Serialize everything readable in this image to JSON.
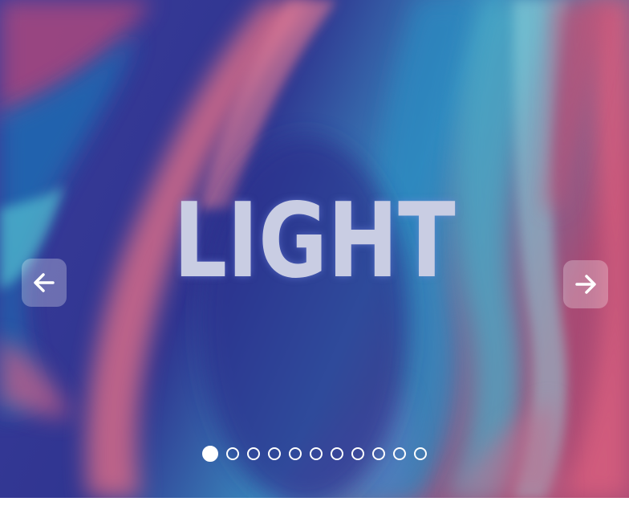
{
  "slide": {
    "title": "LIGHT",
    "colors": {
      "title": "#c9cde3",
      "deep_blue": "#33338f",
      "pink": "#d96a8a",
      "cyan": "#3ea6c2"
    }
  },
  "navigation": {
    "prev_icon": "arrow-left-icon",
    "next_icon": "arrow-right-icon"
  },
  "pagination": {
    "total": 11,
    "current": 1
  }
}
